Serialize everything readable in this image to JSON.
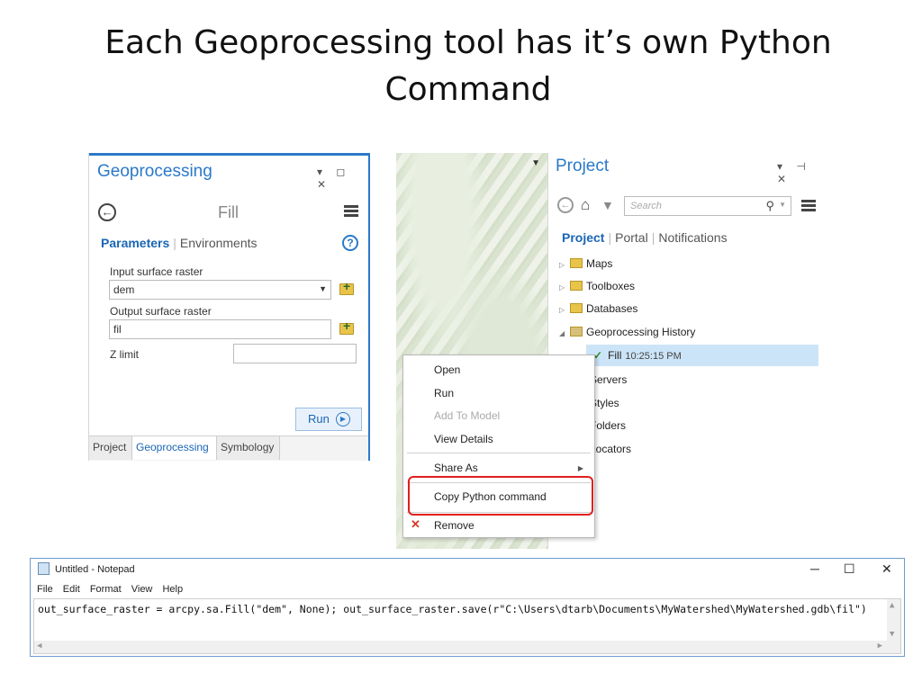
{
  "slide": {
    "title": "Each Geoprocessing tool has it’s own Python Command"
  },
  "geoprocessing_pane": {
    "title": "Geoprocessing",
    "controls": "▾ ◻ ✕",
    "tool_name": "Fill",
    "tabs": {
      "parameters": "Parameters",
      "environments": "Environments"
    },
    "help_icon": "?",
    "fields": [
      {
        "label": "Input surface raster",
        "value": "dem"
      },
      {
        "label": "Output surface raster",
        "value": "fil"
      },
      {
        "label": "Z limit",
        "value": ""
      }
    ],
    "run_label": "Run",
    "bottom_tabs": [
      "Project",
      "Geoprocessing",
      "Symbology"
    ],
    "selected_tab": "Geoprocessing",
    "accent_color": "#2b79c8"
  },
  "project_pane": {
    "title": "Project",
    "controls": "▾ ⊣ ✕",
    "search_placeholder": "Search",
    "tabs": {
      "project": "Project",
      "portal": "Portal",
      "notifications": "Notifications"
    },
    "tree": [
      {
        "label": "Maps",
        "icon": "maps-folder-icon"
      },
      {
        "label": "Toolboxes",
        "icon": "toolboxes-folder-icon"
      },
      {
        "label": "Databases",
        "icon": "databases-folder-icon"
      },
      {
        "label": "Geoprocessing History",
        "icon": "history-folder-icon"
      }
    ],
    "history_entry": {
      "label": "Fill",
      "time": "10:25:15 PM"
    },
    "partial_items": [
      "Servers",
      "Styles",
      "Folders",
      "Locators"
    ]
  },
  "context_menu": {
    "items": [
      {
        "label": "Open",
        "enabled": true
      },
      {
        "label": "Run",
        "enabled": true
      },
      {
        "label": "Add To Model",
        "enabled": false
      },
      {
        "label": "View Details",
        "enabled": true
      },
      {
        "label": "Share As",
        "enabled": true
      },
      {
        "label": "Copy Python command",
        "enabled": true
      },
      {
        "label": "Remove",
        "enabled": true
      }
    ],
    "highlight_color": "#e01f1f"
  },
  "notepad": {
    "title": "Untitled - Notepad",
    "window_controls": [
      "─",
      "☐",
      "✕"
    ],
    "menu": [
      "File",
      "Edit",
      "Format",
      "View",
      "Help"
    ],
    "content": "out_surface_raster = arcpy.sa.Fill(\"dem\", None); out_surface_raster.save(r\"C:\\Users\\dtarb\\Documents\\MyWatershed\\MyWatershed.gdb\\fil\")"
  }
}
